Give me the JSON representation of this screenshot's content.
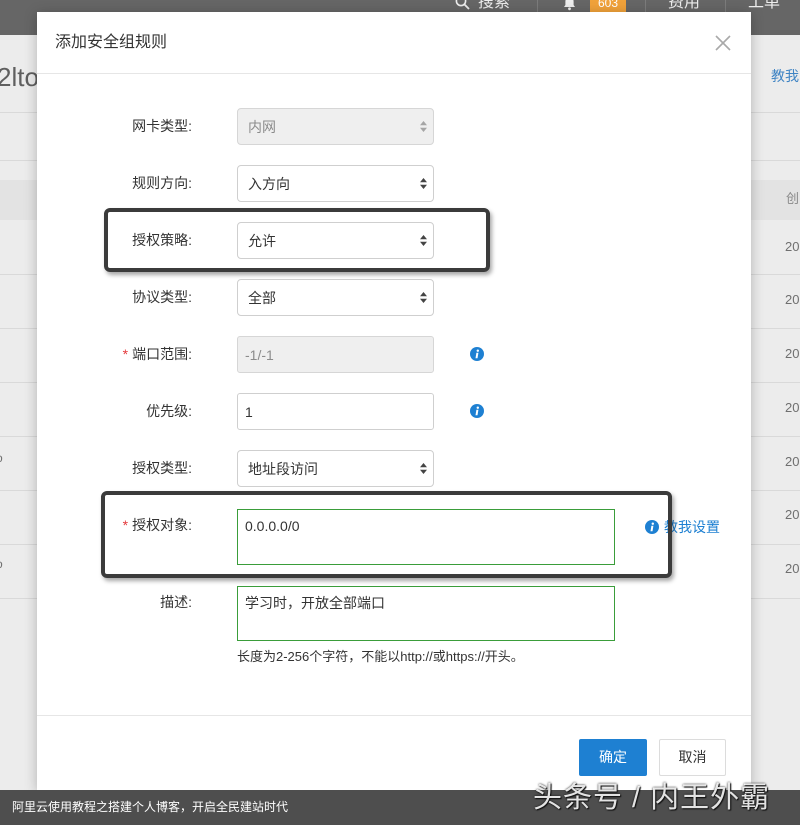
{
  "topbar": {
    "search_label": "搜索",
    "notification_count": "603",
    "cost_label": "费用",
    "ticket_label": "工单"
  },
  "background_page": {
    "title_fragment": "2lto",
    "help_link_fragment": "教我",
    "table_header_fragment": "创",
    "table_row_fragments": [
      "20",
      "20",
      "20",
      "20",
      "20",
      "20",
      "20"
    ],
    "left_edge_fragments": [
      "o",
      "o"
    ]
  },
  "dialog": {
    "title": "添加安全组规则",
    "fields": {
      "nic_type": {
        "label": "网卡类型:",
        "value": "内网",
        "disabled": true
      },
      "direction": {
        "label": "规则方向:",
        "value": "入方向"
      },
      "policy": {
        "label": "授权策略:",
        "value": "允许"
      },
      "protocol": {
        "label": "协议类型:",
        "value": "全部"
      },
      "port_range": {
        "required_mark": "*",
        "label": "端口范围:",
        "value": "-1/-1",
        "disabled": true
      },
      "priority": {
        "label": "优先级:",
        "value": "1"
      },
      "auth_type": {
        "label": "授权类型:",
        "value": "地址段访问"
      },
      "auth_object": {
        "required_mark": "*",
        "label": "授权对象:",
        "value": "0.0.0.0/0",
        "help_link": "教我设置"
      },
      "description": {
        "label": "描述:",
        "value": "学习时，开放全部端口",
        "hint": "长度为2-256个字符，不能以http://或https://开头。"
      }
    },
    "confirm_label": "确定",
    "cancel_label": "取消"
  },
  "caption": {
    "text": "阿里云使用教程之搭建个人博客，开启全民建站时代",
    "watermark": "头条号 / 内王外霸"
  },
  "icons": {
    "search": "search-icon",
    "notifications": "bell-icon",
    "close": "close-icon",
    "info": "info-icon",
    "select_arrows": "select-arrows-icon"
  },
  "colors": {
    "accent": "#1e80d2",
    "link": "#1e80d2",
    "required_mark": "#e4393c",
    "active_border": "#3a9d3a",
    "callout_frame": "#3b3b3b",
    "badge": "#f1a23a",
    "topbar": "#666666"
  }
}
